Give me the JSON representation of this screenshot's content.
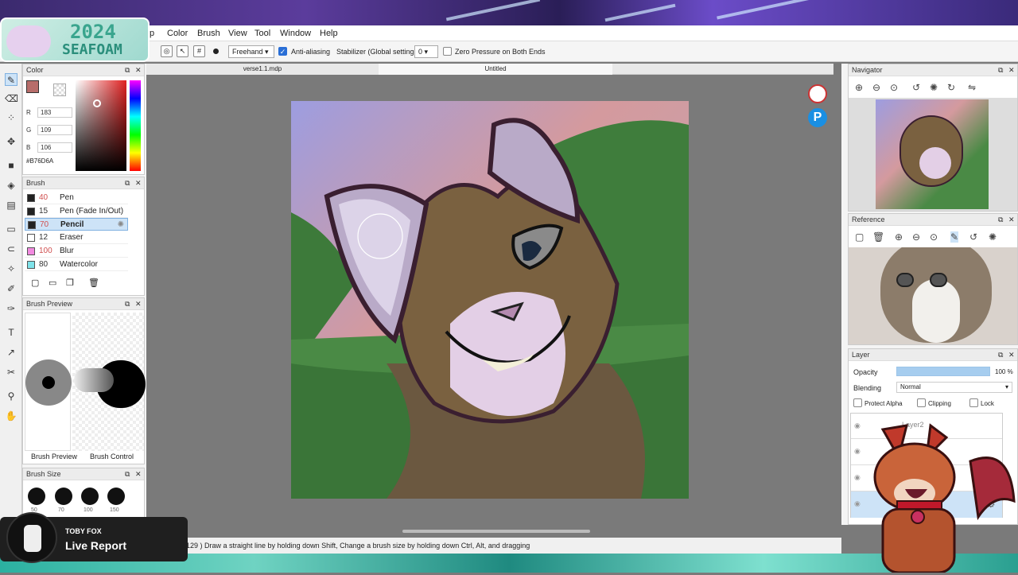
{
  "menubar": {
    "items": [
      "p",
      "Color",
      "Brush",
      "View",
      "Tool",
      "Window",
      "Help"
    ]
  },
  "logo": {
    "year": "2024",
    "name": "SEAFOAM"
  },
  "toolbar": {
    "mode": "Freehand",
    "antialias_label": "Anti-aliasing",
    "stabilizer_label": "Stabilizer (Global settings)",
    "stabilizer_value": "0",
    "zero_pressure_label": "Zero Pressure on Both Ends"
  },
  "tabs": {
    "file1": "verse1.1.mdp",
    "file2": "Untitled"
  },
  "color_panel": {
    "title": "Color",
    "r_label": "R",
    "r": "183",
    "g_label": "G",
    "g": "109",
    "b_label": "B",
    "b": "106",
    "hex": "#B76D6A",
    "current_color": "#B76D6A"
  },
  "brush_panel": {
    "title": "Brush",
    "items": [
      {
        "size": "40",
        "name": "Pen",
        "color": "#222222",
        "size_color": "#d05050"
      },
      {
        "size": "15",
        "name": "Pen (Fade In/Out)",
        "color": "#222222",
        "size_color": "#333333"
      },
      {
        "size": "70",
        "name": "Pencil",
        "color": "#222222",
        "size_color": "#d05050"
      },
      {
        "size": "12",
        "name": "Eraser",
        "color": "#ffffff",
        "size_color": "#333333"
      },
      {
        "size": "100",
        "name": "Blur",
        "color": "#f28ae0",
        "size_color": "#d05050"
      },
      {
        "size": "80",
        "name": "Watercolor",
        "color": "#7fe3ea",
        "size_color": "#333333"
      }
    ]
  },
  "brush_preview": {
    "title": "Brush Preview",
    "tab1": "Brush Preview",
    "tab2": "Brush Control"
  },
  "brush_size": {
    "title": "Brush Size",
    "sizes": [
      "50",
      "70",
      "100",
      "150"
    ]
  },
  "navigator": {
    "title": "Navigator"
  },
  "reference": {
    "title": "Reference"
  },
  "layer": {
    "title": "Layer",
    "opacity_label": "Opacity",
    "opacity_value": "100 %",
    "opacity_fraction": 1.0,
    "blending_label": "Blending",
    "blending_value": "Normal",
    "protect_alpha": "Protect Alpha",
    "clipping": "Clipping",
    "lock": "Lock",
    "layer_name": "Layer2"
  },
  "status": {
    "text": "129 )  Draw a straight line by holding down Shift, Change a brush size by holding down Ctrl, Alt, and dragging"
  },
  "live": {
    "name": "TOBY FOX",
    "title": "Live Report"
  }
}
